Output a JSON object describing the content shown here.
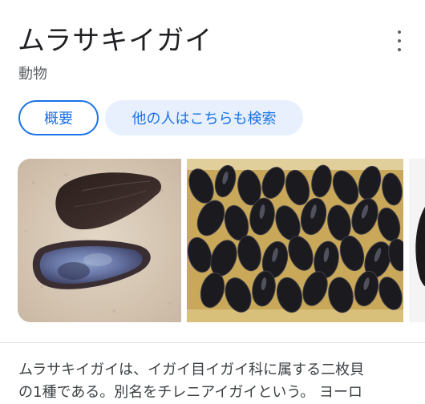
{
  "knowledge_panel": {
    "title": "ムラサキイガイ",
    "subtitle": "動物",
    "more_icon": "more-vert-icon",
    "chips": [
      {
        "label": "概要",
        "selected": true
      },
      {
        "label": "他の人はこちらも検索",
        "selected": false
      }
    ],
    "images": [
      {
        "description": "mussel shells on sand"
      },
      {
        "description": "cluster of black mussels"
      },
      {
        "description": "mussel (partially visible)"
      }
    ],
    "description_lines": [
      "ムラサキイガイは、イガイ目イガイ科に属する二枚貝",
      "の1種である。別名をチレニアイガイという。 ヨーロ"
    ]
  },
  "colors": {
    "accent": "#1a73e8",
    "chip_inactive_bg": "#e8f0fe",
    "text_primary": "#202124",
    "text_secondary": "#5f6368"
  }
}
